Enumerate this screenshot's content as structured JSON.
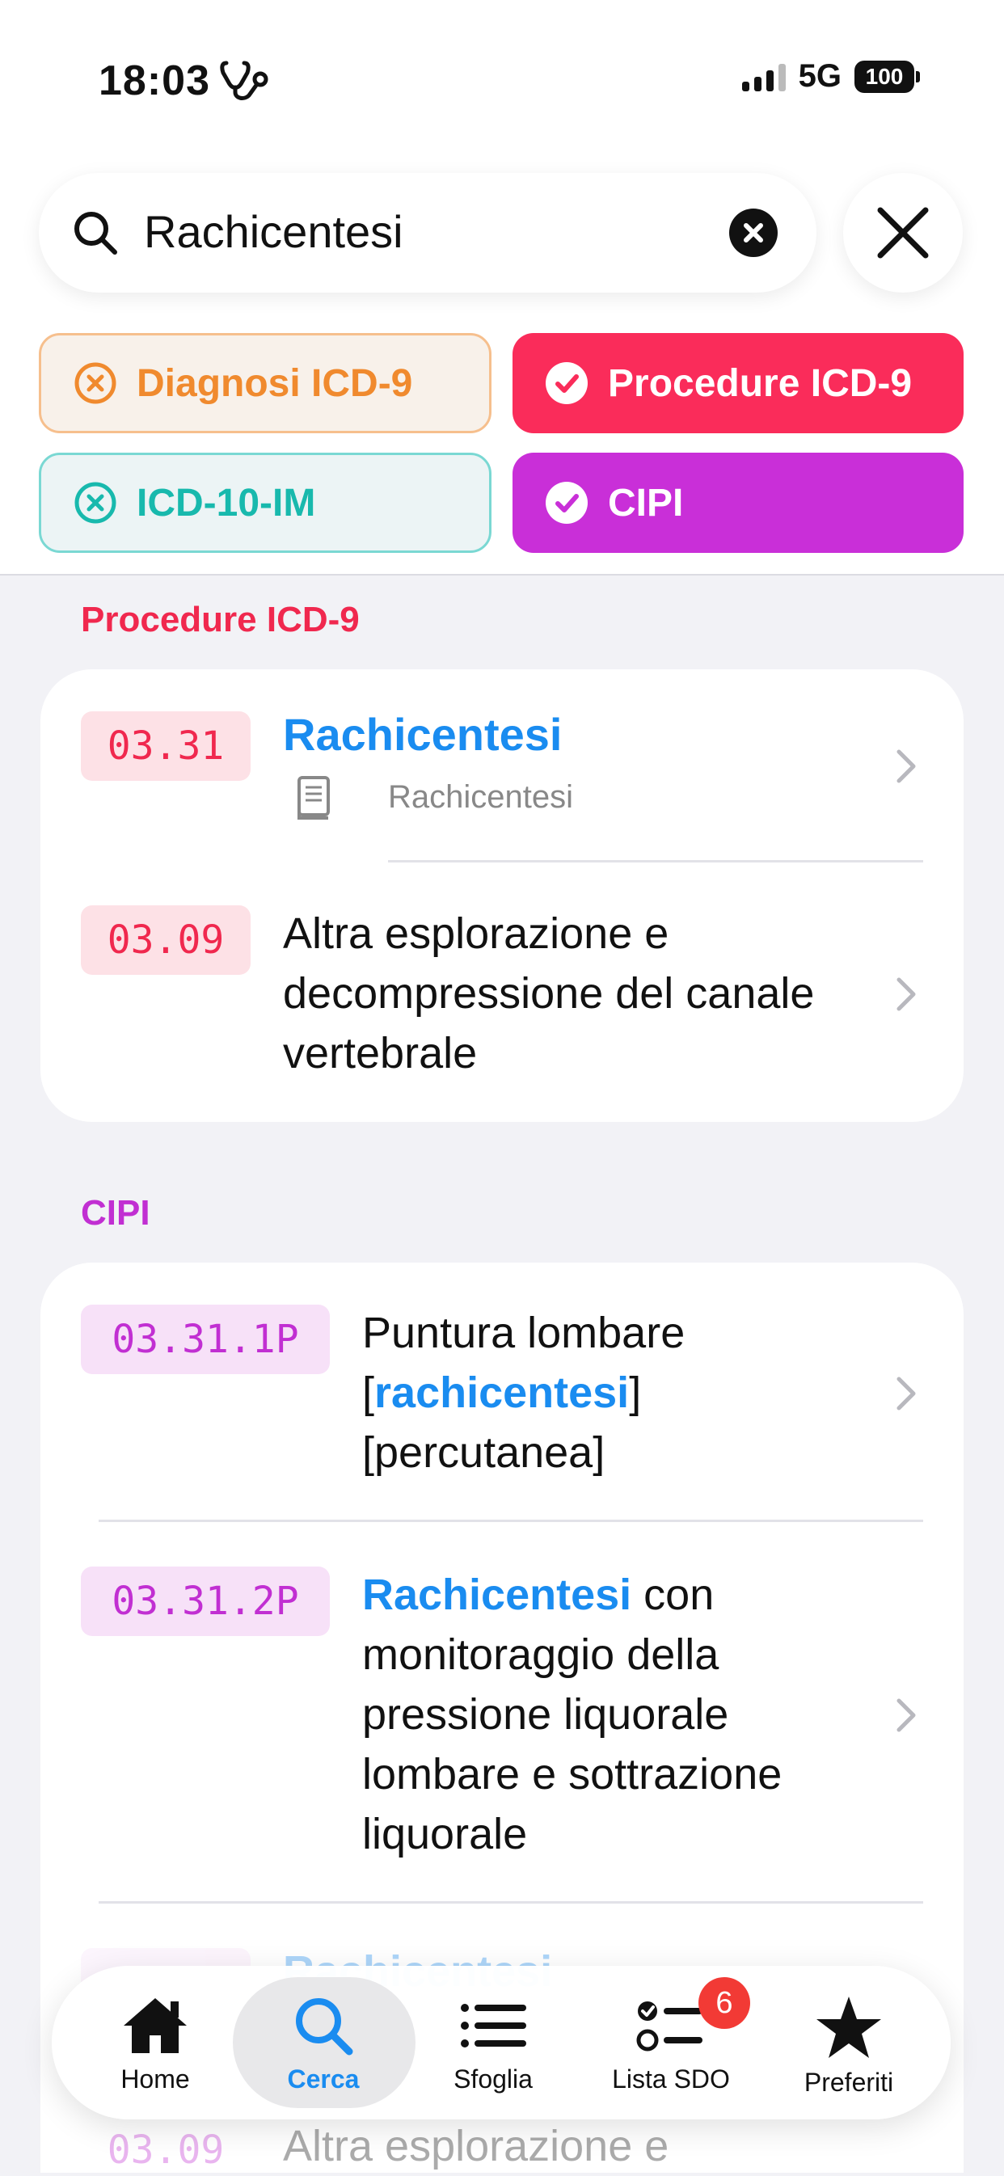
{
  "status_bar": {
    "time": "18:03",
    "network": "5G",
    "battery": "100"
  },
  "search": {
    "query": "Rachicentesi"
  },
  "filters": [
    {
      "label": "Diagnosi ICD-9",
      "selected": false,
      "color": "#f08a2e"
    },
    {
      "label": "Procedure ICD-9",
      "selected": true,
      "color": "#fa2c5a"
    },
    {
      "label": "ICD-10-IM",
      "selected": false,
      "color": "#18b9ad"
    },
    {
      "label": "CIPI",
      "selected": true,
      "color": "#c92fd8"
    }
  ],
  "sections": [
    {
      "title": "Procedure ICD-9",
      "items": [
        {
          "code": "03.31",
          "title": "Rachicentesi",
          "subtitle": "Rachicentesi"
        },
        {
          "code": "03.09",
          "lines": [
            "Altra esplorazione e",
            "decompressione del canale",
            "vertebrale"
          ]
        }
      ]
    },
    {
      "title": "CIPI",
      "items": [
        {
          "code": "03.31.1P",
          "line1": "Puntura lombare",
          "line2_open": "[",
          "line2_highlight": "rachicentesi",
          "line2_close": "]",
          "line3": "[percutanea]"
        },
        {
          "code": "03.31.2P",
          "highlight": "Rachicentesi",
          "line1_rest": " con",
          "lines": [
            "monitoraggio della",
            "pressione liquorale",
            "lombare e sottrazione",
            "liquorale"
          ]
        },
        {
          "code": "03.09",
          "title": "Rachicentesi",
          "lines": [
            "Altra esplorazione e"
          ]
        }
      ]
    }
  ],
  "tabbar": {
    "tabs": [
      {
        "label": "Home",
        "icon": "house-icon"
      },
      {
        "label": "Cerca",
        "icon": "magnifier-icon",
        "active": true
      },
      {
        "label": "Sfoglia",
        "icon": "list-icon"
      },
      {
        "label": "Lista SDO",
        "icon": "checklist-icon",
        "badge": "6"
      },
      {
        "label": "Preferiti",
        "icon": "star-icon"
      }
    ]
  },
  "colors": {
    "accent_blue": "#1a8cf0",
    "icd9_pink": "#fa2c5a",
    "cipi_purple": "#c92fd8"
  }
}
